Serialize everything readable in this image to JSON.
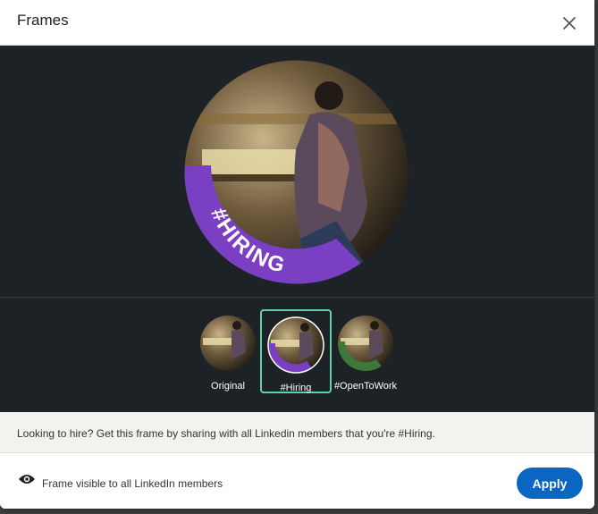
{
  "dialog": {
    "title": "Frames",
    "close_icon": "close-icon"
  },
  "frames": [
    {
      "label": "Original",
      "ring": "none",
      "selected": false
    },
    {
      "label": "#Hiring",
      "ring": "#7a3fc2",
      "selected": true
    },
    {
      "label": "#OpenToWork",
      "ring": "#3d7a3a",
      "selected": false
    }
  ],
  "preview": {
    "ring_text": "#HIRING",
    "ring_color": "#7a3fc2"
  },
  "info": {
    "text": "Looking to hire? Get this frame by sharing with all Linkedin members that you're #Hiring."
  },
  "footer": {
    "visibility_icon": "eye-icon",
    "visibility_text": "Frame visible to all LinkedIn members",
    "apply_label": "Apply"
  },
  "colors": {
    "accent": "#0a66c2",
    "dark_bg": "#1d2226",
    "selected_border": "#5fd3a5",
    "hiring_purple": "#7a3fc2",
    "opentowork_green": "#3d7a3a"
  }
}
